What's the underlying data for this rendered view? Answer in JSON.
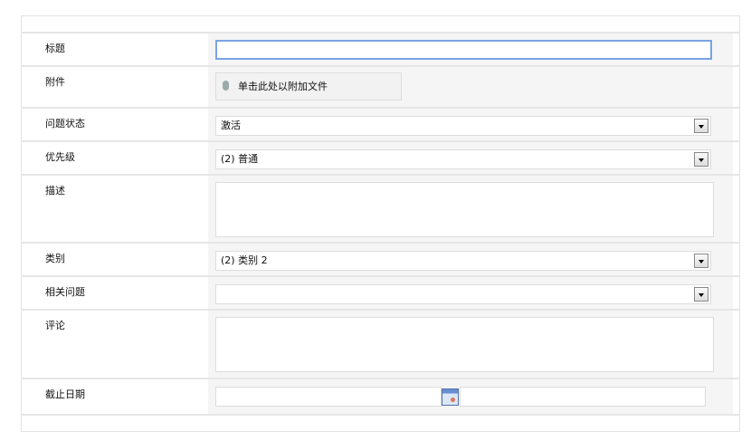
{
  "fields": {
    "title": {
      "label": "标题",
      "value": ""
    },
    "attachment": {
      "label": "附件",
      "button": "单击此处以附加文件"
    },
    "status": {
      "label": "问题状态",
      "value": "激活"
    },
    "priority": {
      "label": "优先级",
      "value": "(2) 普通"
    },
    "description": {
      "label": "描述",
      "value": ""
    },
    "category": {
      "label": "类别",
      "value": "(2) 类别 2"
    },
    "related": {
      "label": "相关问题",
      "value": ""
    },
    "comment": {
      "label": "评论",
      "value": ""
    },
    "due_date": {
      "label": "截止日期",
      "value": ""
    }
  }
}
